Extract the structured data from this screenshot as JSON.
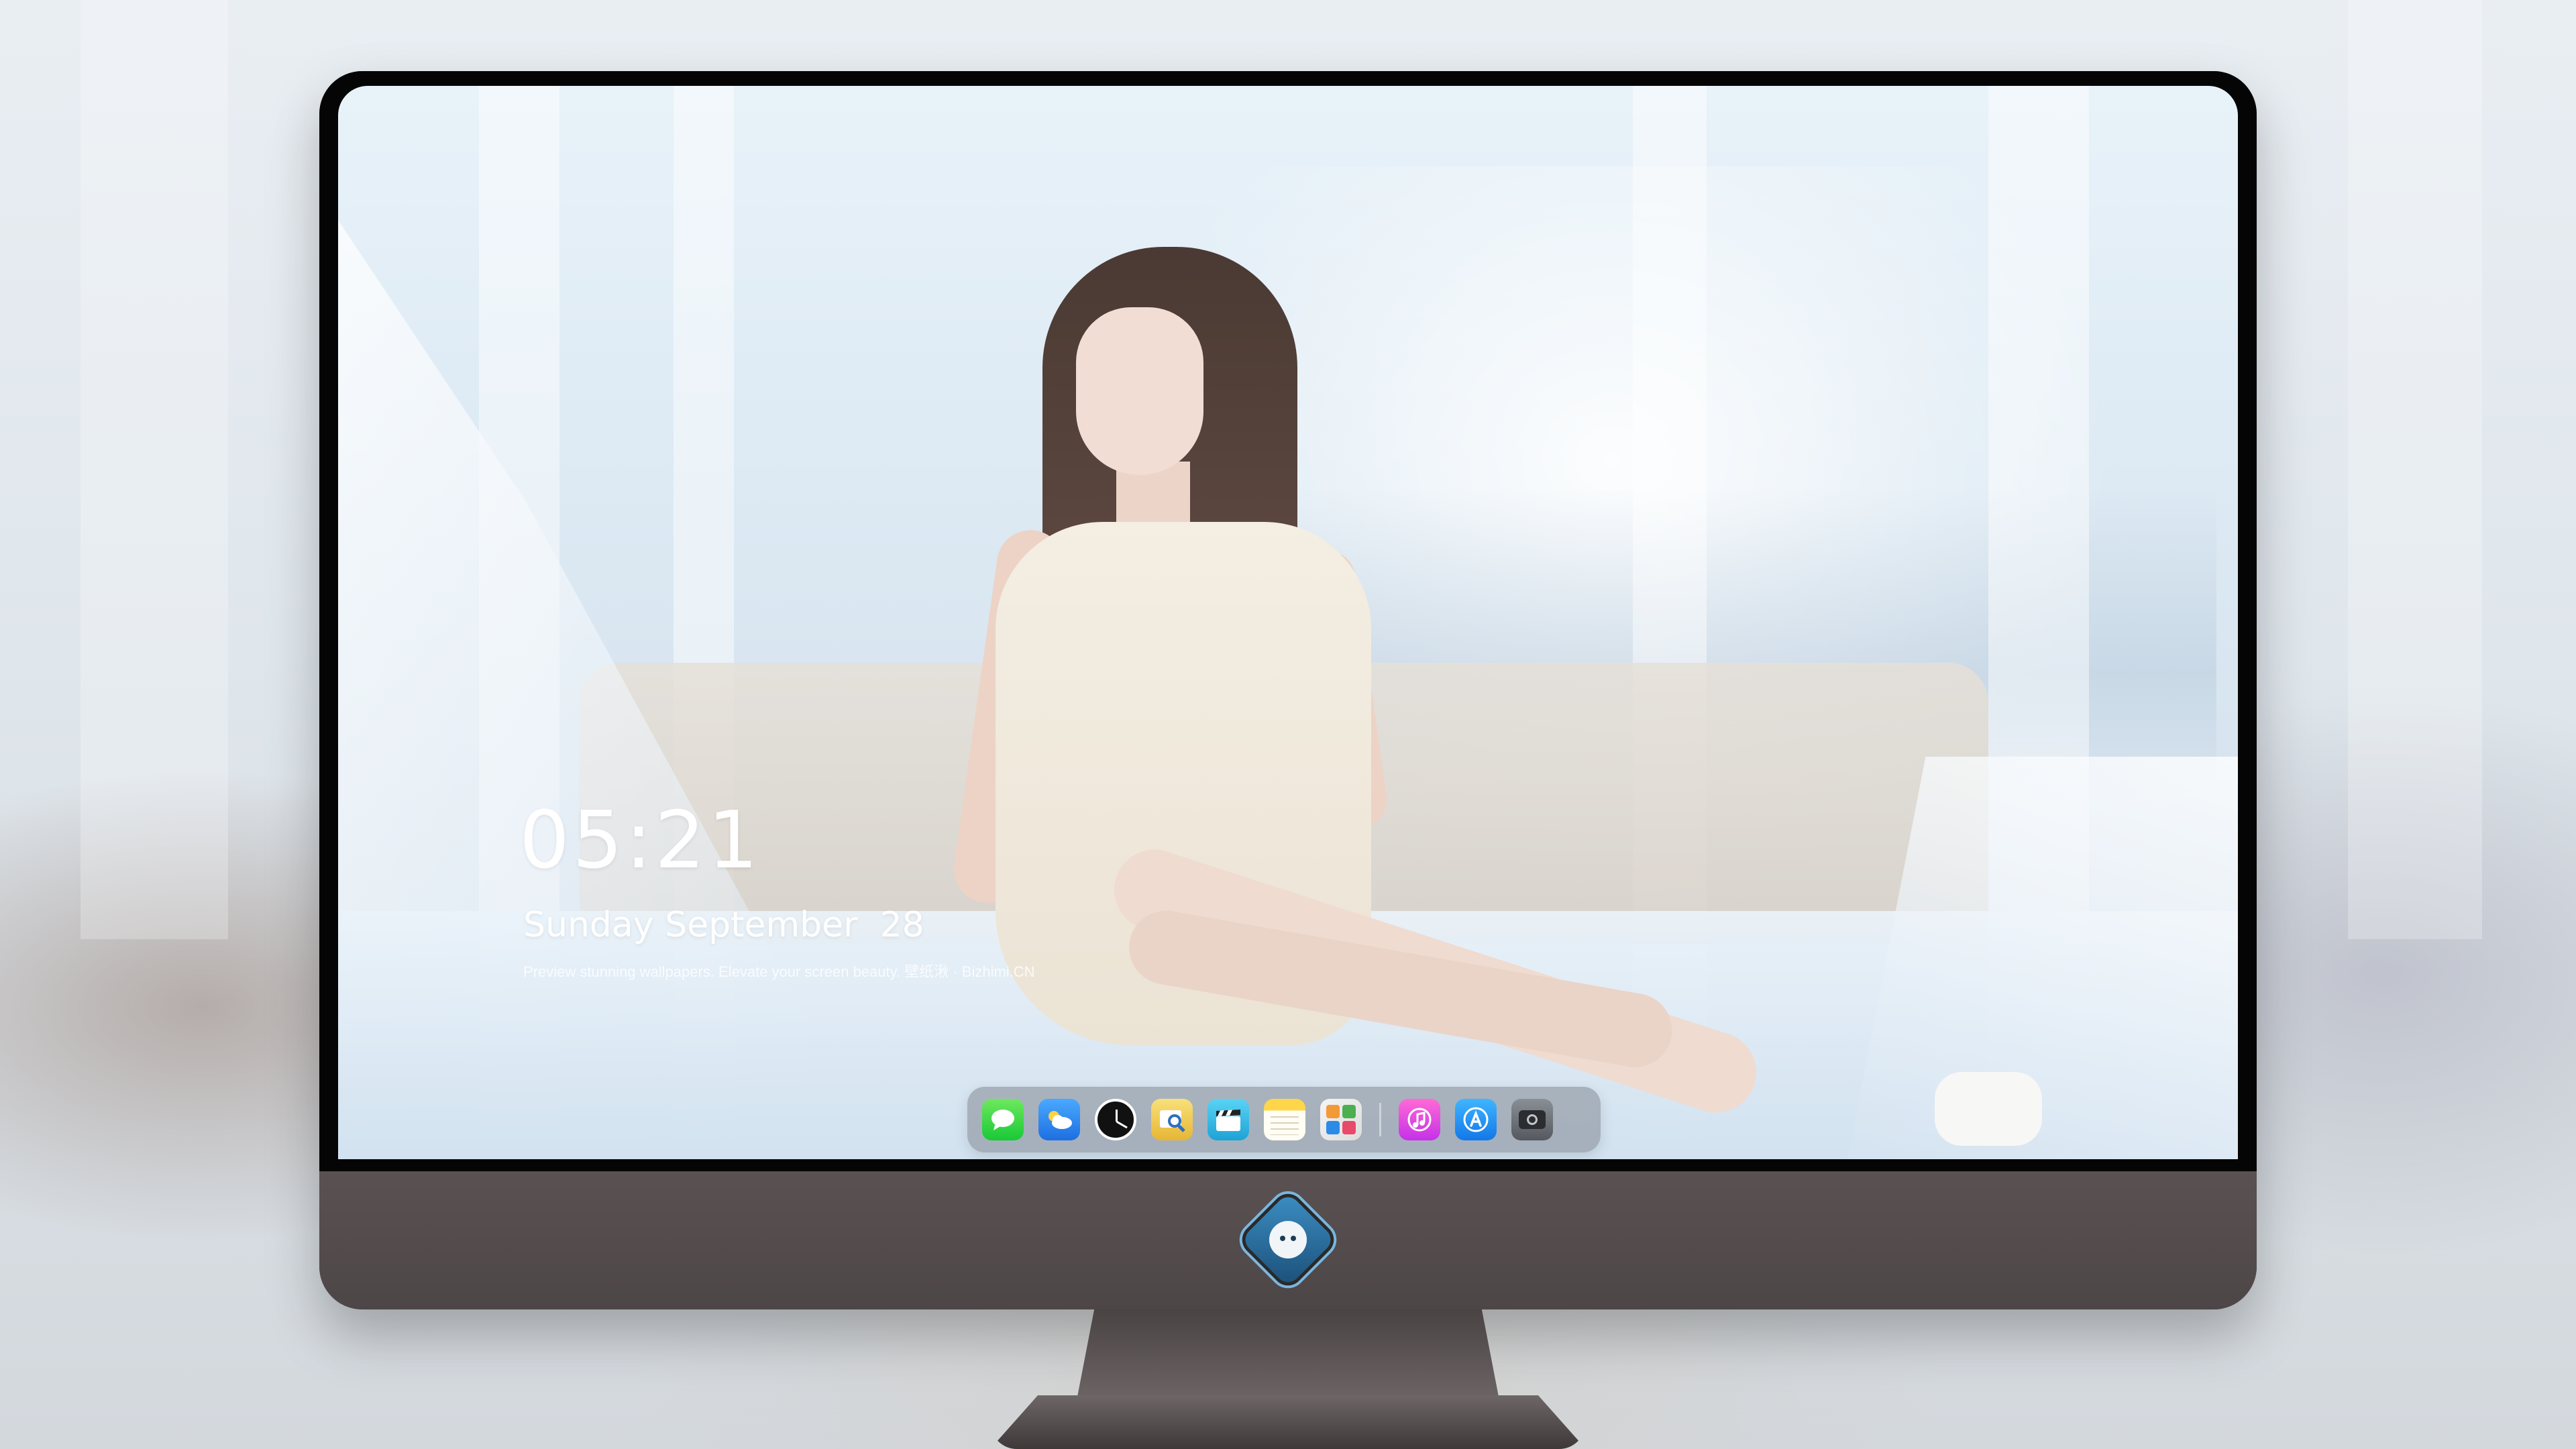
{
  "lockscreen": {
    "time": "05:21",
    "date": "Sunday September  28",
    "tagline": "Preview stunning wallpapers. Elevate your screen beauty. 壁纸湫 · Bizhimi.CN"
  },
  "dock": {
    "apps": [
      {
        "name": "Messages",
        "icon": "message-bubble-icon",
        "color": "#2ad13f"
      },
      {
        "name": "Weather",
        "icon": "cloud-sun-icon",
        "color": "#2f86f0"
      },
      {
        "name": "Clock",
        "icon": "clock-icon",
        "color": "#111111"
      },
      {
        "name": "Preview",
        "icon": "preview-icon",
        "color": "#efc94c"
      },
      {
        "name": "Clips",
        "icon": "clapperboard-icon",
        "color": "#36bce6"
      },
      {
        "name": "Notes",
        "icon": "notes-icon",
        "color": "#ffd54a"
      },
      {
        "name": "Photos",
        "icon": "photos-icon",
        "color": "#e5e5e5"
      },
      {
        "name": "Music",
        "icon": "music-note-icon",
        "color": "#e046e0"
      },
      {
        "name": "App Store",
        "icon": "app-store-icon",
        "color": "#2196f3"
      },
      {
        "name": "Camera",
        "icon": "camera-icon",
        "color": "#6f7379"
      }
    ]
  },
  "monitor": {
    "logo_icon": "dragon-mascot-icon",
    "bezel_color": "#050505",
    "body_color": "#585253"
  }
}
